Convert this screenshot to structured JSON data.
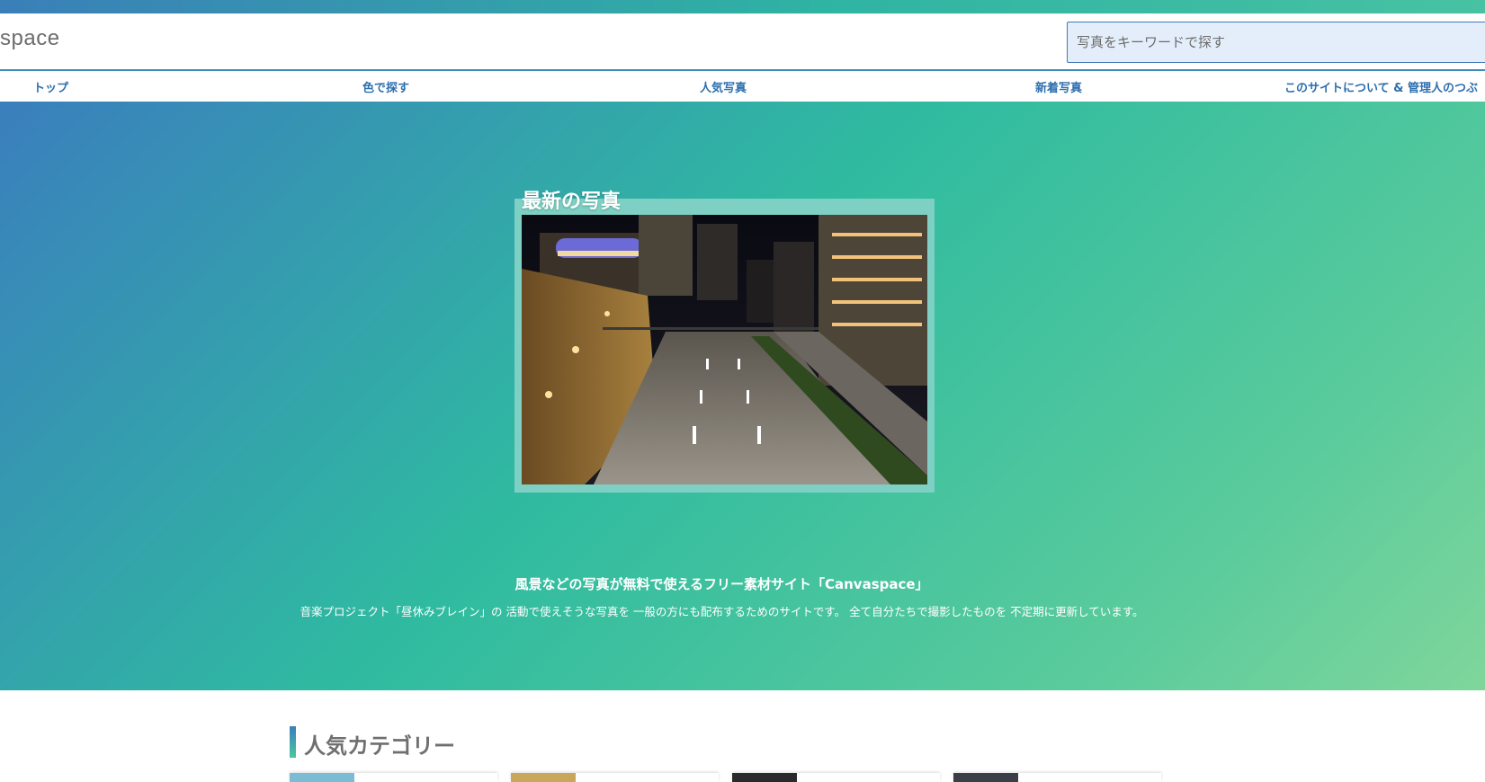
{
  "header": {
    "logo_text": "space",
    "search_placeholder": "写真をキーワードで探す"
  },
  "nav": {
    "items": [
      {
        "label": "トップ"
      },
      {
        "label": "色で探す"
      },
      {
        "label": "人気写真"
      },
      {
        "label": "新着写真"
      },
      {
        "label": "このサイトについて & 管理人のつぶ"
      }
    ]
  },
  "hero": {
    "latest_title": "最新の写真",
    "desc_title": "風景などの写真が無料で使えるフリー素材サイト「Canvaspace」",
    "desc_body": "音楽プロジェクト「昼休みブレイン」の 活動で使えそうな写真を 一般の方にも配布するためのサイトです。 全て自分たちで撮影したものを 不定期に更新しています。"
  },
  "popular": {
    "title": "人気カテゴリー"
  },
  "colors": {
    "accent_blue": "#2d6fae",
    "hero_start": "#3a7fbd",
    "hero_end": "#7fd69b"
  }
}
